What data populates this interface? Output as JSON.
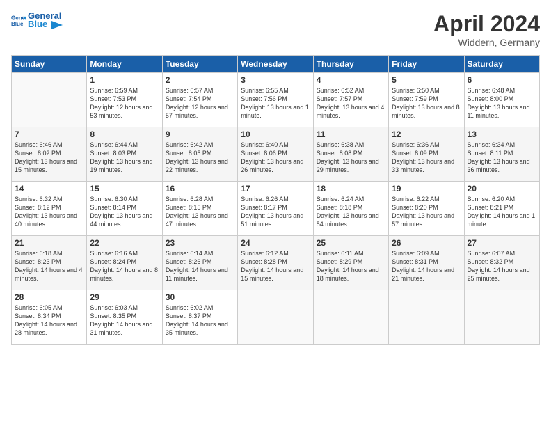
{
  "header": {
    "logo_general": "General",
    "logo_blue": "Blue",
    "month_year": "April 2024",
    "location": "Widdern, Germany"
  },
  "days_of_week": [
    "Sunday",
    "Monday",
    "Tuesday",
    "Wednesday",
    "Thursday",
    "Friday",
    "Saturday"
  ],
  "weeks": [
    [
      {
        "day": "",
        "empty": true
      },
      {
        "day": "1",
        "sunrise": "6:59 AM",
        "sunset": "7:53 PM",
        "daylight": "12 hours and 53 minutes."
      },
      {
        "day": "2",
        "sunrise": "6:57 AM",
        "sunset": "7:54 PM",
        "daylight": "12 hours and 57 minutes."
      },
      {
        "day": "3",
        "sunrise": "6:55 AM",
        "sunset": "7:56 PM",
        "daylight": "13 hours and 1 minute."
      },
      {
        "day": "4",
        "sunrise": "6:52 AM",
        "sunset": "7:57 PM",
        "daylight": "13 hours and 4 minutes."
      },
      {
        "day": "5",
        "sunrise": "6:50 AM",
        "sunset": "7:59 PM",
        "daylight": "13 hours and 8 minutes."
      },
      {
        "day": "6",
        "sunrise": "6:48 AM",
        "sunset": "8:00 PM",
        "daylight": "13 hours and 11 minutes."
      }
    ],
    [
      {
        "day": "7",
        "sunrise": "6:46 AM",
        "sunset": "8:02 PM",
        "daylight": "13 hours and 15 minutes."
      },
      {
        "day": "8",
        "sunrise": "6:44 AM",
        "sunset": "8:03 PM",
        "daylight": "13 hours and 19 minutes."
      },
      {
        "day": "9",
        "sunrise": "6:42 AM",
        "sunset": "8:05 PM",
        "daylight": "13 hours and 22 minutes."
      },
      {
        "day": "10",
        "sunrise": "6:40 AM",
        "sunset": "8:06 PM",
        "daylight": "13 hours and 26 minutes."
      },
      {
        "day": "11",
        "sunrise": "6:38 AM",
        "sunset": "8:08 PM",
        "daylight": "13 hours and 29 minutes."
      },
      {
        "day": "12",
        "sunrise": "6:36 AM",
        "sunset": "8:09 PM",
        "daylight": "13 hours and 33 minutes."
      },
      {
        "day": "13",
        "sunrise": "6:34 AM",
        "sunset": "8:11 PM",
        "daylight": "13 hours and 36 minutes."
      }
    ],
    [
      {
        "day": "14",
        "sunrise": "6:32 AM",
        "sunset": "8:12 PM",
        "daylight": "13 hours and 40 minutes."
      },
      {
        "day": "15",
        "sunrise": "6:30 AM",
        "sunset": "8:14 PM",
        "daylight": "13 hours and 44 minutes."
      },
      {
        "day": "16",
        "sunrise": "6:28 AM",
        "sunset": "8:15 PM",
        "daylight": "13 hours and 47 minutes."
      },
      {
        "day": "17",
        "sunrise": "6:26 AM",
        "sunset": "8:17 PM",
        "daylight": "13 hours and 51 minutes."
      },
      {
        "day": "18",
        "sunrise": "6:24 AM",
        "sunset": "8:18 PM",
        "daylight": "13 hours and 54 minutes."
      },
      {
        "day": "19",
        "sunrise": "6:22 AM",
        "sunset": "8:20 PM",
        "daylight": "13 hours and 57 minutes."
      },
      {
        "day": "20",
        "sunrise": "6:20 AM",
        "sunset": "8:21 PM",
        "daylight": "14 hours and 1 minute."
      }
    ],
    [
      {
        "day": "21",
        "sunrise": "6:18 AM",
        "sunset": "8:23 PM",
        "daylight": "14 hours and 4 minutes."
      },
      {
        "day": "22",
        "sunrise": "6:16 AM",
        "sunset": "8:24 PM",
        "daylight": "14 hours and 8 minutes."
      },
      {
        "day": "23",
        "sunrise": "6:14 AM",
        "sunset": "8:26 PM",
        "daylight": "14 hours and 11 minutes."
      },
      {
        "day": "24",
        "sunrise": "6:12 AM",
        "sunset": "8:28 PM",
        "daylight": "14 hours and 15 minutes."
      },
      {
        "day": "25",
        "sunrise": "6:11 AM",
        "sunset": "8:29 PM",
        "daylight": "14 hours and 18 minutes."
      },
      {
        "day": "26",
        "sunrise": "6:09 AM",
        "sunset": "8:31 PM",
        "daylight": "14 hours and 21 minutes."
      },
      {
        "day": "27",
        "sunrise": "6:07 AM",
        "sunset": "8:32 PM",
        "daylight": "14 hours and 25 minutes."
      }
    ],
    [
      {
        "day": "28",
        "sunrise": "6:05 AM",
        "sunset": "8:34 PM",
        "daylight": "14 hours and 28 minutes."
      },
      {
        "day": "29",
        "sunrise": "6:03 AM",
        "sunset": "8:35 PM",
        "daylight": "14 hours and 31 minutes."
      },
      {
        "day": "30",
        "sunrise": "6:02 AM",
        "sunset": "8:37 PM",
        "daylight": "14 hours and 35 minutes."
      },
      {
        "day": "",
        "empty": true
      },
      {
        "day": "",
        "empty": true
      },
      {
        "day": "",
        "empty": true
      },
      {
        "day": "",
        "empty": true
      }
    ]
  ],
  "labels": {
    "sunrise_prefix": "Sunrise: ",
    "sunset_prefix": "Sunset: ",
    "daylight_prefix": "Daylight: "
  }
}
